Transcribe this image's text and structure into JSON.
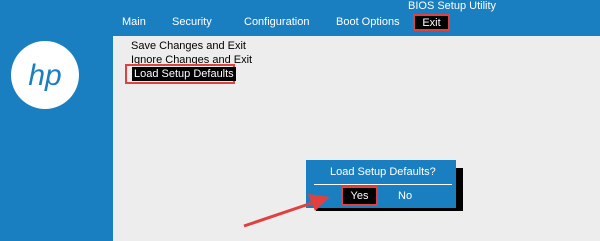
{
  "window": {
    "title": "BIOS Setup Utility"
  },
  "menu": {
    "items": [
      {
        "label": "Main"
      },
      {
        "label": "Security"
      },
      {
        "label": "Configuration"
      },
      {
        "label": "Boot Options"
      },
      {
        "label": "Exit"
      }
    ]
  },
  "exit_menu": {
    "options": [
      {
        "label": "Save Changes and Exit"
      },
      {
        "label": "Ignore Changes and Exit"
      },
      {
        "label": "Load Setup Defaults"
      }
    ]
  },
  "dialog": {
    "title": "Load Setup Defaults?",
    "yes_label": "Yes",
    "no_label": "No"
  },
  "colors": {
    "bios_blue": "#1a7fc1",
    "highlight_red": "#e04040",
    "content_gray": "#ededed"
  },
  "icons": {
    "logo": "hp-logo-icon",
    "annotation": "red-arrow-icon"
  }
}
